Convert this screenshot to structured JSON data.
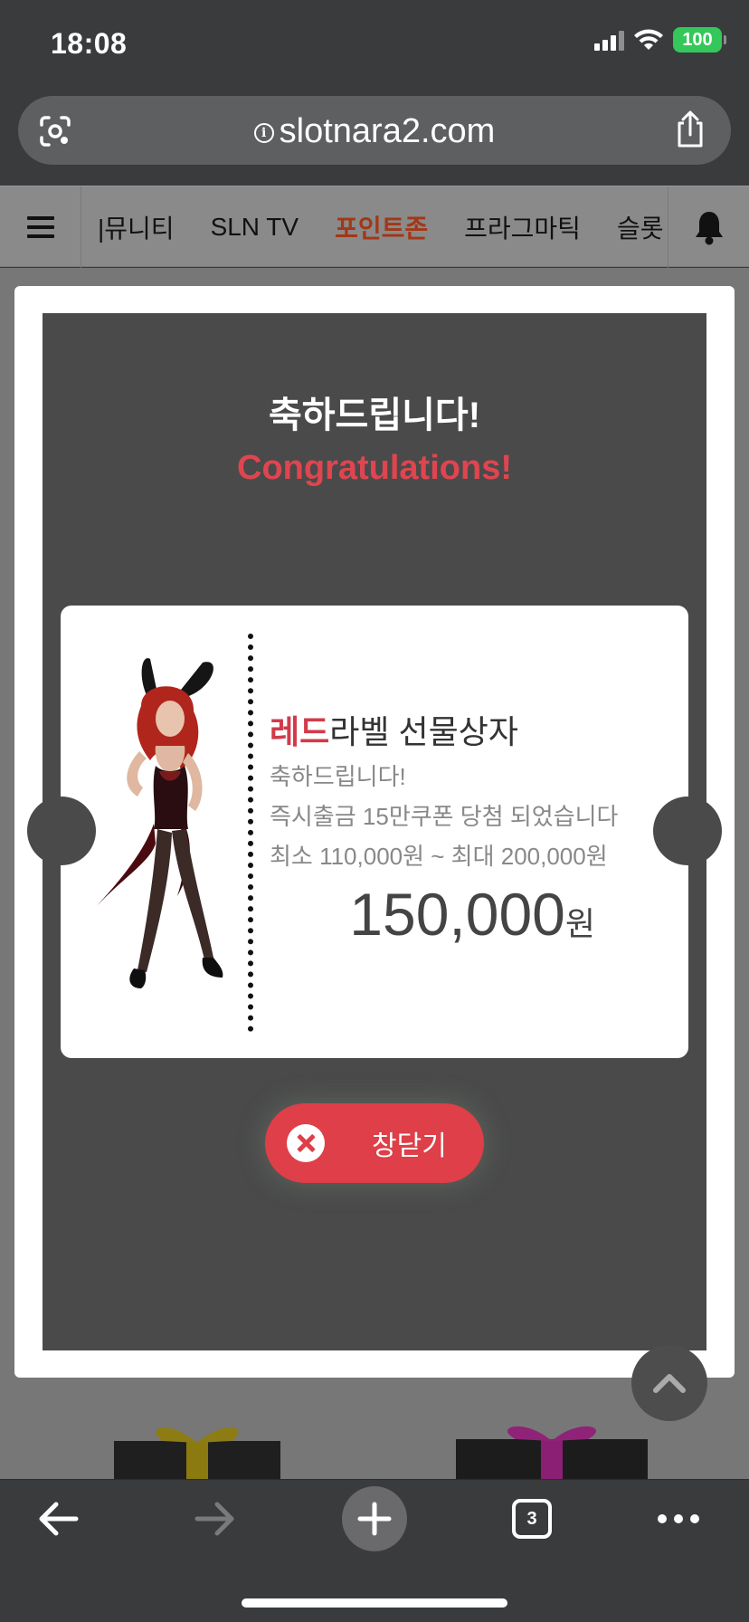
{
  "status_bar": {
    "time": "18:08",
    "battery": "100",
    "icons": [
      "signal-icon",
      "wifi-icon",
      "battery-icon"
    ]
  },
  "browser": {
    "url": "slotnara2.com",
    "icons": [
      "lens-icon",
      "info-icon",
      "share-icon"
    ]
  },
  "site_nav": {
    "items": [
      {
        "label": "|뮤니티"
      },
      {
        "label": "SLN TV"
      },
      {
        "label": "포인트존",
        "active": true
      },
      {
        "label": "프라그마틱"
      },
      {
        "label": "슬롯"
      }
    ],
    "icons": [
      "menu-icon",
      "bell-icon"
    ]
  },
  "modal": {
    "title_ko": "축하드립니다!",
    "title_en": "Congratulations!",
    "gift": {
      "title_highlight": "레드",
      "title_rest": "라벨 선물상자",
      "line1": "축하드립니다!",
      "line2": "즉시출금 15만쿠폰 당첨 되었습니다",
      "line3": "최소 110,000원 ~ 최대 200,000원",
      "amount": "150,000",
      "currency": "원"
    },
    "close_label": "창닫기"
  },
  "toolbar": {
    "tab_count": "3",
    "icons": [
      "back-icon",
      "forward-icon",
      "new-tab-icon",
      "tabs-icon",
      "more-icon"
    ]
  },
  "colors": {
    "accent_red": "#de3f48",
    "nav_active": "#a33716",
    "modal_bg": "#4a4a4b",
    "chrome_bg": "#3a3b3d"
  }
}
